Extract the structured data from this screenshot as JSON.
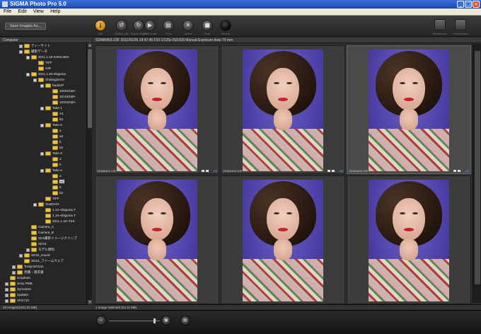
{
  "window": {
    "title": "SIGMA Photo Pro 5.0",
    "min": "_",
    "max": "□",
    "close": "×"
  },
  "menu": [
    "File",
    "Edit",
    "View",
    "Help"
  ],
  "toolbar": {
    "save_label": "Save Images As...",
    "button_labels": [
      "Info",
      "Rotate Left",
      "Rotate Right",
      "Slide Show",
      "Print",
      "Delete",
      "Stop",
      "Review",
      "Check",
      "Preferences",
      "Information"
    ]
  },
  "sidebar": {
    "header": "Computer",
    "items": [
      {
        "label": "ティーサイト",
        "depth": 3,
        "exp": "+"
      },
      {
        "label": "撮影データ",
        "depth": 3,
        "exp": "-"
      },
      {
        "label": "2011.1.19-SHISUIMA",
        "depth": 4,
        "exp": "-"
      },
      {
        "label": "TIFF",
        "depth": 5,
        "exp": ""
      },
      {
        "label": "X3F",
        "depth": 5,
        "exp": ""
      },
      {
        "label": "2011.1.26-shiguma",
        "depth": 4,
        "exp": "-"
      },
      {
        "label": "ShotingDATA",
        "depth": 5,
        "exp": "-"
      },
      {
        "label": "baukUP",
        "depth": 6,
        "exp": "-"
      },
      {
        "label": "100SIGMA",
        "depth": 7,
        "exp": ""
      },
      {
        "label": "101SIGMA",
        "depth": 7,
        "exp": ""
      },
      {
        "label": "102SIGMA",
        "depth": 7,
        "exp": ""
      },
      {
        "label": "Take-1",
        "depth": 6,
        "exp": "-"
      },
      {
        "label": "A1",
        "depth": 7,
        "exp": ""
      },
      {
        "label": "B1",
        "depth": 7,
        "exp": ""
      },
      {
        "label": "Take-2",
        "depth": 6,
        "exp": "-"
      },
      {
        "label": "a",
        "depth": 7,
        "exp": ""
      },
      {
        "label": "a2",
        "depth": 7,
        "exp": ""
      },
      {
        "label": "b",
        "depth": 7,
        "exp": ""
      },
      {
        "label": "b2",
        "depth": 7,
        "exp": ""
      },
      {
        "label": "Take-3",
        "depth": 6,
        "exp": "-"
      },
      {
        "label": "a",
        "depth": 7,
        "exp": ""
      },
      {
        "label": "b",
        "depth": 7,
        "exp": ""
      },
      {
        "label": "Take-4",
        "depth": 6,
        "exp": "-"
      },
      {
        "label": "a",
        "depth": 7,
        "exp": ""
      },
      {
        "label": "a2",
        "depth": 7,
        "exp": "",
        "selected": true
      },
      {
        "label": "b",
        "depth": 7,
        "exp": ""
      },
      {
        "label": "b2",
        "depth": 7,
        "exp": ""
      },
      {
        "label": "TIFF",
        "depth": 6,
        "exp": ""
      },
      {
        "label": "TextDATA",
        "depth": 5,
        "exp": "-"
      },
      {
        "label": "1.13~shiguma T",
        "depth": 6,
        "exp": ""
      },
      {
        "label": "1.16~shiguma T",
        "depth": 6,
        "exp": ""
      },
      {
        "label": "2011.1.18~TES",
        "depth": 6,
        "exp": ""
      },
      {
        "label": "Camera_A",
        "depth": 4,
        "exp": ""
      },
      {
        "label": "Camera_B",
        "depth": 4,
        "exp": ""
      },
      {
        "label": "SD1撮影イメージクリップ",
        "depth": 4,
        "exp": ""
      },
      {
        "label": "SD15",
        "depth": 4,
        "exp": ""
      },
      {
        "label": "モデル資料",
        "depth": 4,
        "exp": "+"
      },
      {
        "label": "SD15_sound",
        "depth": 3,
        "exp": "+"
      },
      {
        "label": "SD15_ファームウェア",
        "depth": 3,
        "exp": ""
      },
      {
        "label": "Torayo201111",
        "depth": 2,
        "exp": "+"
      },
      {
        "label": "見積・請求書",
        "depth": 2,
        "exp": "+"
      },
      {
        "label": "sd1photo",
        "depth": 1,
        "exp": ""
      },
      {
        "label": "Sony PMB",
        "depth": 1,
        "exp": "+"
      },
      {
        "label": "Symantec",
        "depth": 1,
        "exp": "+"
      },
      {
        "label": "Updater",
        "depth": 1,
        "exp": "+"
      },
      {
        "label": "XPS710",
        "depth": 1,
        "exp": "+"
      }
    ]
  },
  "main": {
    "header": "SDIM0403.X3F 2011/01/26 19:47:46 F10 1/125s ISO100 Manual Exposure Auto 70 mm",
    "thumbnails": [
      {
        "name": "SDIM0401.X3F",
        "ext": "x3f",
        "selected": false
      },
      {
        "name": "SDIM0402.X3F",
        "ext": "x3f",
        "selected": false
      },
      {
        "name": "SDIM0403.X3F",
        "ext": "x3f",
        "selected": true
      },
      {
        "name": "",
        "ext": "",
        "selected": false
      },
      {
        "name": "",
        "ext": "",
        "selected": false
      },
      {
        "name": "",
        "ext": "",
        "selected": false
      }
    ]
  },
  "status": {
    "left": "29 Images(1501.00 MB)",
    "right": "1 Image Selected (54.11 MB)"
  },
  "colors": {
    "titlebar": "#1f4fb8",
    "folder": "#e9c24a",
    "accent": "#c57e12",
    "background": "#2b2b2b"
  }
}
